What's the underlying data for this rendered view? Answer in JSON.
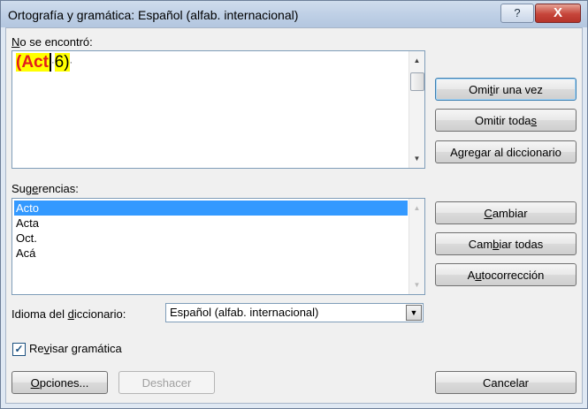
{
  "window": {
    "title": "Ortografía y gramática: Español (alfab. internacional)",
    "help_label": "?",
    "close_label": "X"
  },
  "not_found": {
    "label_prefix": "N",
    "label_rest": "o se encontró:",
    "paren_open": "(",
    "error_word": "Act",
    "space_mark": "·",
    "rest_text": "6)",
    "end_mark": "·"
  },
  "suggestions": {
    "label_pre": "Sug",
    "label_key": "e",
    "label_post": "rencias:",
    "items": [
      "Acto",
      "Acta",
      "Oct.",
      "Acá"
    ],
    "selected_index": 0
  },
  "buttons": {
    "ignore_once": {
      "pre": "Omi",
      "key": "t",
      "post": "ir una vez"
    },
    "ignore_all": {
      "pre": "Omitir toda",
      "key": "s",
      "post": ""
    },
    "add_dict": {
      "pre": "A",
      "key": "g",
      "post": "regar al diccionario"
    },
    "change": {
      "pre": "",
      "key": "C",
      "post": "ambiar"
    },
    "change_all": {
      "pre": "Cam",
      "key": "b",
      "post": "iar todas"
    },
    "autocorrect": {
      "pre": "A",
      "key": "u",
      "post": "tocorrección"
    },
    "options": {
      "pre": "",
      "key": "O",
      "post": "pciones..."
    },
    "undo": "Deshacer",
    "cancel": "Cancelar"
  },
  "dictionary": {
    "label_pre": "Idioma del ",
    "label_key": "d",
    "label_post": "iccionario:",
    "value": "Español (alfab. internacional)"
  },
  "grammar_check": {
    "checked": true,
    "label_pre": "Re",
    "label_key": "v",
    "label_post": "isar gramática"
  },
  "icons": {
    "scroll_up": "▲",
    "scroll_down": "▼",
    "combo_arrow": "▼",
    "check": "✓"
  },
  "colors": {
    "error_text": "#e31c1c",
    "highlight": "#ffff00",
    "selection": "#3399ff"
  }
}
